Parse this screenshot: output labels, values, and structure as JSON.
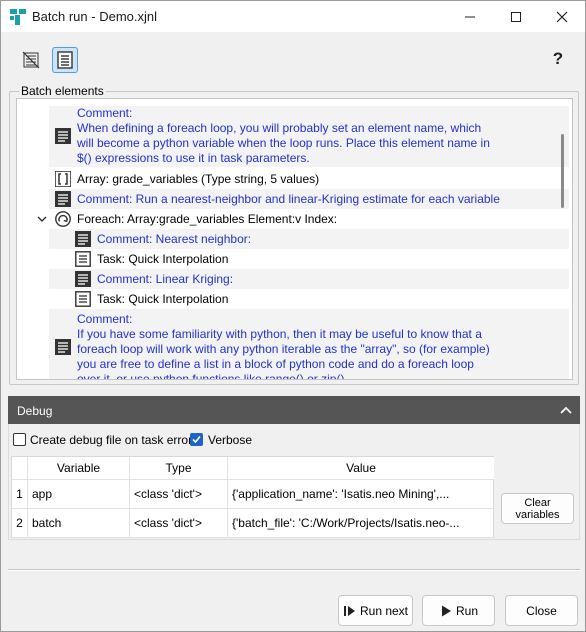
{
  "window": {
    "title": "Batch run - Demo.xjnl",
    "minimize_icon": "minimize-icon",
    "maximize_icon": "maximize-icon",
    "close_icon": "close-icon"
  },
  "toolbar": {
    "tool1_icon": "strikethrough-list-icon",
    "tool2_icon": "document-lines-icon",
    "help_label": "?"
  },
  "batch": {
    "group_label": "Batch elements",
    "elements": [
      {
        "kind": "comment",
        "text": "Comment:\nWhen defining a foreach loop, you will probably set an element name, which\nwill become a python variable when the loop runs.  Place this element name in\n$() expressions to use it in task parameters."
      },
      {
        "kind": "array",
        "text": "Array: grade_variables (Type string, 5 values)"
      },
      {
        "kind": "comment",
        "text": "Comment: Run a nearest-neighbor and linear-Kriging estimate for each variable"
      },
      {
        "kind": "foreach",
        "text": "Foreach: Array:grade_variables Element:v Index:"
      },
      {
        "kind": "comment",
        "text": "Comment: Nearest neighbor:"
      },
      {
        "kind": "task",
        "text": "Task: Quick Interpolation"
      },
      {
        "kind": "comment",
        "text": "Comment: Linear Kriging:"
      },
      {
        "kind": "task",
        "text": "Task: Quick Interpolation"
      },
      {
        "kind": "comment",
        "text": "Comment:\nIf you have some familiarity with python, then it may be useful to know that a\nforeach loop will work with any python iterable as the \"array\", so (for example)\nyou are free to define a list in a block of python code and do a foreach loop\nover it, or use python functions like range() or zip()."
      }
    ]
  },
  "debug": {
    "label": "Debug",
    "create_debug_file_label": "Create debug file on task error",
    "create_debug_file_checked": false,
    "verbose_label": "Verbose",
    "verbose_checked": true,
    "table": {
      "columns": [
        "Variable",
        "Type",
        "Value"
      ],
      "rows": [
        {
          "num": "1",
          "variable": "app",
          "type": "<class 'dict'>",
          "value": "{'application_name': 'Isatis.neo Mining',..."
        },
        {
          "num": "2",
          "variable": "batch",
          "type": "<class 'dict'>",
          "value": "{'batch_file': 'C:/Work/Projects/Isatis.neo-..."
        }
      ]
    },
    "clear_variables_label": "Clear\nvariables"
  },
  "footer": {
    "run_next_label": "Run next",
    "run_label": "Run",
    "close_label": "Close"
  },
  "colors": {
    "comment_text": "#2233cc",
    "accent": "#1e63c6",
    "debug_header": "#555555",
    "app_icon": "#1aa0a8"
  }
}
